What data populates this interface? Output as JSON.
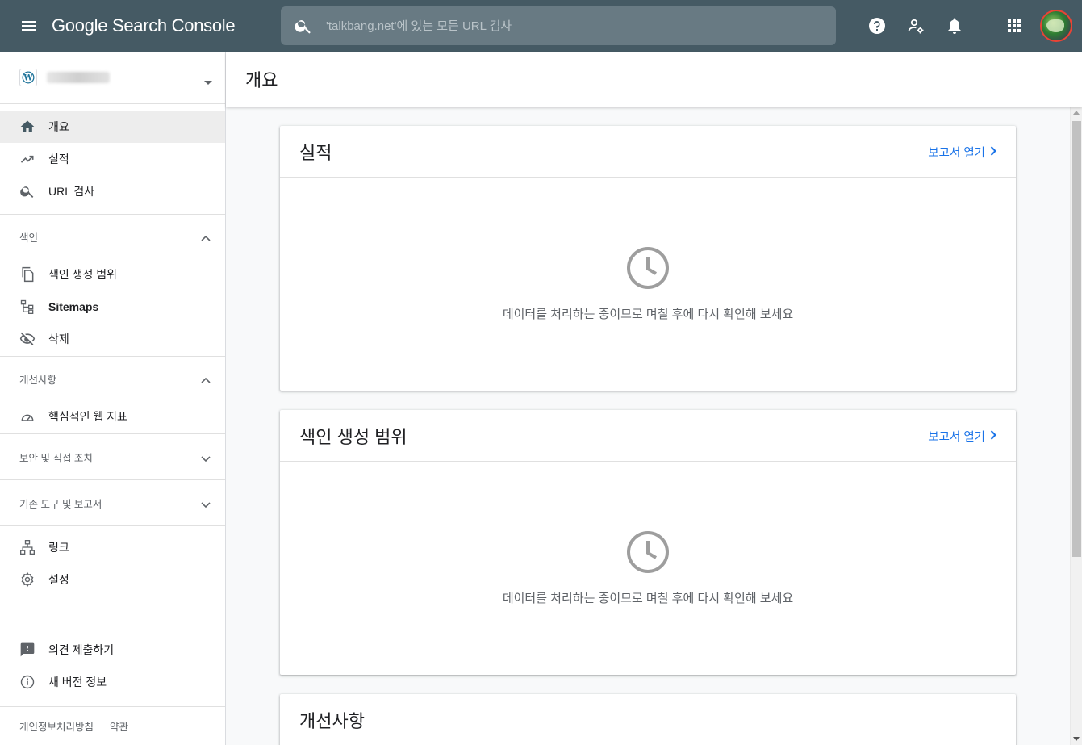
{
  "header": {
    "app_name": "Google Search Console",
    "search_placeholder": "'talkbang.net'에 있는 모든 URL 검사",
    "icons": [
      "menu-icon",
      "search-icon",
      "help-icon",
      "manage-users-icon",
      "notifications-icon",
      "apps-icon",
      "avatar"
    ]
  },
  "sidebar": {
    "property_icon": "wordpress-icon",
    "nav_top": [
      {
        "label": "개요",
        "icon": "home-icon"
      },
      {
        "label": "실적",
        "icon": "trending-up-icon"
      },
      {
        "label": "URL 검사",
        "icon": "search-icon"
      }
    ],
    "sections": {
      "index": {
        "title": "색인",
        "items": [
          {
            "label": "색인 생성 범위",
            "icon": "copy-icon"
          },
          {
            "label": "Sitemaps",
            "icon": "sitemap-icon"
          },
          {
            "label": "삭제",
            "icon": "visibility-off-icon"
          }
        ]
      },
      "enhancements": {
        "title": "개선사항",
        "items": [
          {
            "label": "핵심적인 웹 지표",
            "icon": "speed-icon"
          }
        ]
      },
      "security": {
        "title": "보안 및 직접 조치"
      },
      "legacy": {
        "title": "기존 도구 및 보고서"
      }
    },
    "nav_bottom": [
      {
        "label": "링크",
        "icon": "links-icon"
      },
      {
        "label": "설정",
        "icon": "settings-icon"
      }
    ],
    "nav_footer": [
      {
        "label": "의견 제출하기",
        "icon": "feedback-icon"
      },
      {
        "label": "새 버전 정보",
        "icon": "info-icon"
      }
    ],
    "footer_links": [
      "개인정보처리방침",
      "약관"
    ]
  },
  "page": {
    "title": "개요"
  },
  "cards": [
    {
      "title": "실적",
      "link": "보고서 열기",
      "message": "데이터를 처리하는 중이므로 며칠 후에 다시 확인해 보세요"
    },
    {
      "title": "색인 생성 범위",
      "link": "보고서 열기",
      "message": "데이터를 처리하는 중이므로 며칠 후에 다시 확인해 보세요"
    },
    {
      "title": "개선사항"
    }
  ],
  "colors": {
    "topbar": "#455a64",
    "link": "#1a73e8",
    "active_nav": "#ededed"
  }
}
